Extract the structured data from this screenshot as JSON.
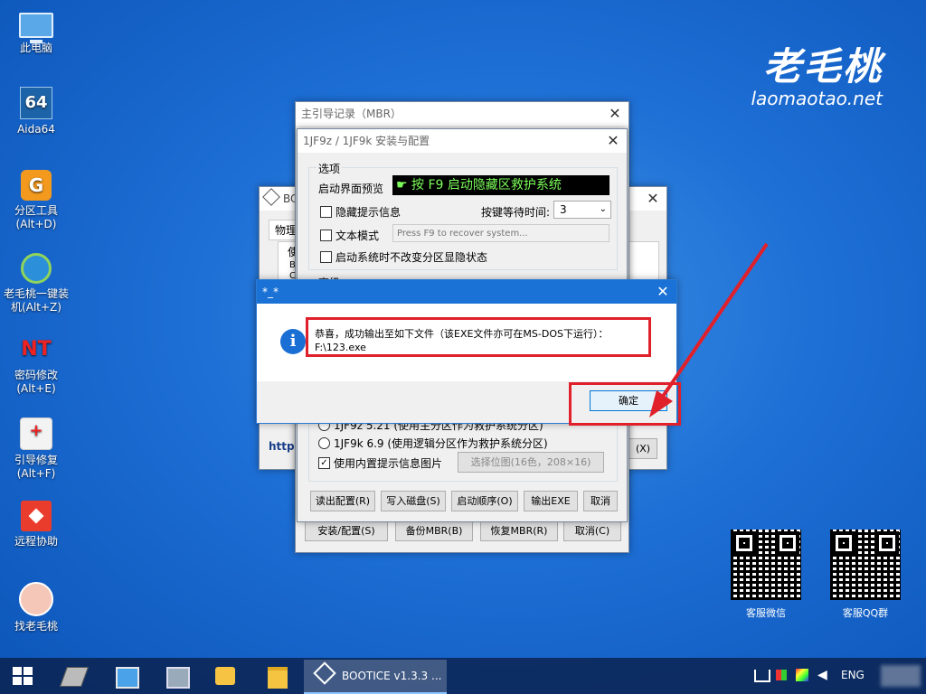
{
  "desktop": {
    "icons": [
      {
        "label": "此电脑",
        "icon": "computer-icon"
      },
      {
        "label": "Aida64",
        "icon": "aida64-icon",
        "glyph": "64"
      },
      {
        "label": "分区工具\n(Alt+D)",
        "icon": "partition-tool-icon",
        "glyph": "G"
      },
      {
        "label": "老毛桃一键装\n机(Alt+Z)",
        "icon": "installer-icon"
      },
      {
        "label": "密码修改\n(Alt+E)",
        "icon": "password-tool-icon",
        "glyph": "NT"
      },
      {
        "label": "引导修复\n(Alt+F)",
        "icon": "boot-repair-icon"
      },
      {
        "label": "远程协助",
        "icon": "remote-assist-icon"
      },
      {
        "label": "找老毛桃",
        "icon": "find-laomaotao-icon"
      }
    ],
    "logo": {
      "text": "老毛桃",
      "url": "laomaotao.net"
    },
    "qr_codes": [
      {
        "label": "客服微信"
      },
      {
        "label": "客服QQ群"
      }
    ]
  },
  "bootice": {
    "title": "BOOTICE v1.3.3 ...",
    "title_short": "BO",
    "tab": "物理",
    "side_fragments": [
      "使",
      "B",
      "C"
    ],
    "http_fragment": "http:",
    "close_fragment": "(X)"
  },
  "mbr_window": {
    "title": "主引导记录（MBR）",
    "buttons": {
      "install": "安装/配置(S)",
      "backup": "备份MBR(B)",
      "restore": "恢复MBR(R)",
      "cancel": "取消(C)"
    }
  },
  "config_window": {
    "title": "1JF9z / 1JF9k 安装与配置",
    "options_label": "选项",
    "preview_label": "启动界面预览",
    "preview_text": "按 F9 启动隐藏区救护系统",
    "hide_tip_label": "隐藏提示信息",
    "wait_time_label": "按键等待时间:",
    "wait_time_value": "3",
    "text_mode_label": "文本模式",
    "text_mode_placeholder": "Press F9 to recover system...",
    "keep_partition_label": "启动系统时不改变分区显隐状态",
    "group2_fragment": "高级",
    "radio1_label": "1JF9z 5.21 (使用主分区作为救护系统分区)",
    "radio2_label": "1JF9k 6.9 (使用逻辑分区作为救护系统分区)",
    "builtin_image_label": "使用内置提示信息图片",
    "choose_bitmap_label": "选择位图(16色，208×16)",
    "buttons": {
      "read": "读出配置(R)",
      "write": "写入磁盘(S)",
      "boot_order": "启动顺序(O)",
      "export": "输出EXE",
      "cancel": "取消"
    }
  },
  "dialog": {
    "title": "*_*",
    "message_line1": "恭喜，成功输出至如下文件（该EXE文件亦可在MS-DOS下运行）：",
    "message_line2": "F:\\123.exe",
    "ok_label": "确定",
    "info_glyph": "i"
  },
  "taskbar": {
    "active_label": "BOOTICE v1.3.3 ...",
    "language": "ENG"
  },
  "colors": {
    "accent": "#1a72d6",
    "annotation_red": "#e0202a",
    "preview_green": "#7cff5a"
  }
}
